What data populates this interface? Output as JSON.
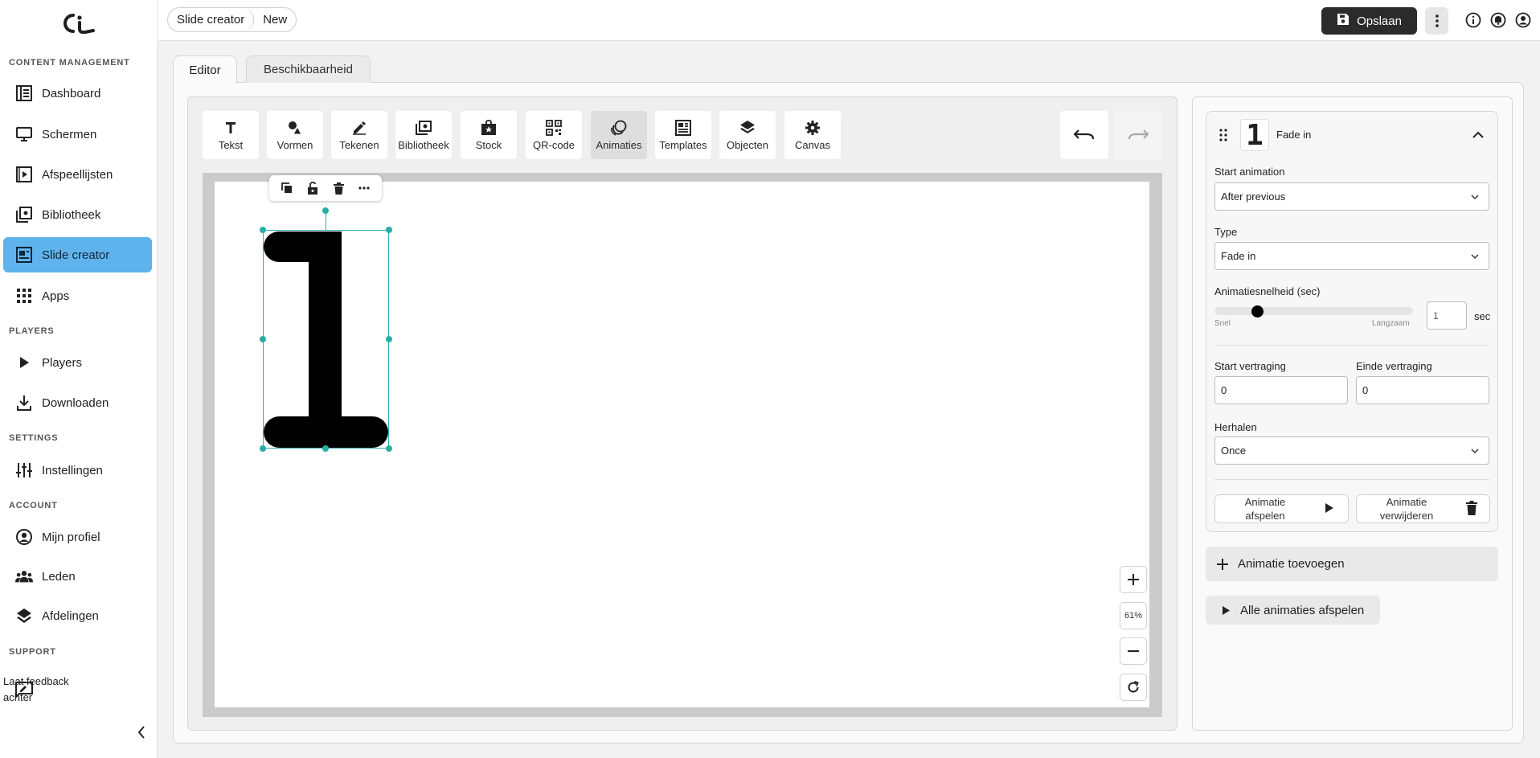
{
  "sidebar": {
    "sections": {
      "content": "CONTENT MANAGEMENT",
      "players": "PLAYERS",
      "settings": "SETTINGS",
      "account": "ACCOUNT",
      "support": "SUPPORT"
    },
    "items": {
      "dashboard": "Dashboard",
      "schermen": "Schermen",
      "afspeellijsten": "Afspeellijsten",
      "bibliotheek": "Bibliotheek",
      "slide_creator": "Slide creator",
      "apps": "Apps",
      "players": "Players",
      "downloaden": "Downloaden",
      "instellingen": "Instellingen",
      "mijn_profiel": "Mijn profiel",
      "leden": "Leden",
      "afdelingen": "Afdelingen",
      "feedback": "Laat feedback achter"
    },
    "active_color": "#5fb3ec"
  },
  "topbar": {
    "breadcrumb": [
      "Slide creator",
      "New"
    ],
    "save_label": "Opslaan"
  },
  "tabs": [
    "Editor",
    "Beschikbaarheid"
  ],
  "toolbar": {
    "tools": [
      "Tekst",
      "Vormen",
      "Tekenen",
      "Bibliotheek",
      "Stock",
      "QR-code",
      "Animaties",
      "Templates",
      "Objecten",
      "Canvas"
    ],
    "active_tool": "Animaties"
  },
  "canvas": {
    "element_glyph": "1",
    "zoom": "61%",
    "selection_color": "#29aea7"
  },
  "animation": {
    "glyph": "1",
    "title": "Fade in",
    "start_label": "Start animation",
    "start_value": "After previous",
    "type_label": "Type",
    "type_value": "Fade in",
    "speed_label": "Animatiesnelheid (sec)",
    "speed_min_label": "Snel",
    "speed_max_label": "Langzaam",
    "speed_value": "1",
    "speed_unit": "sec",
    "speed_fraction": 0.2,
    "start_delay_label": "Start vertraging",
    "start_delay_value": "0",
    "end_delay_label": "Einde vertraging",
    "end_delay_value": "0",
    "repeat_label": "Herhalen",
    "repeat_value": "Once",
    "play_label_1": "Animatie",
    "play_label_2": "afspelen",
    "delete_label_1": "Animatie",
    "delete_label_2": "verwijderen",
    "add_label": "Animatie toevoegen",
    "play_all_label": "Alle animaties afspelen"
  }
}
